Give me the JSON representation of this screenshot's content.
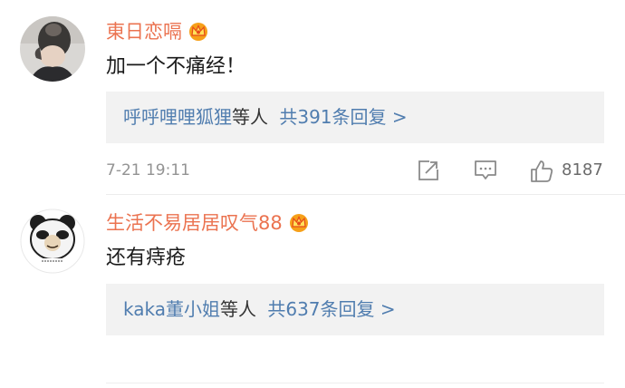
{
  "comments": [
    {
      "username": "東日恋嗝",
      "text": "加一个不痛经！",
      "reply_users": "呼呼哩哩狐狸",
      "reply_etc": "等人",
      "reply_total": "共391条回复 >",
      "time": "7-21 19:11",
      "likes": "8187",
      "badge_icon": "vip-crown-icon",
      "avatar": "photo-avatar"
    },
    {
      "username": "生活不易居居叹气88",
      "text": "还有痔疮",
      "reply_users": "kaka董小姐",
      "reply_etc": "等人",
      "reply_total": "共637条回复 >",
      "avatar": "panda-meme-avatar",
      "badge_icon": "vip-crown-icon"
    }
  ],
  "colors": {
    "username": "#eb7350",
    "link": "#507daf",
    "reply_bg": "#f2f2f2",
    "meta": "#939393"
  }
}
